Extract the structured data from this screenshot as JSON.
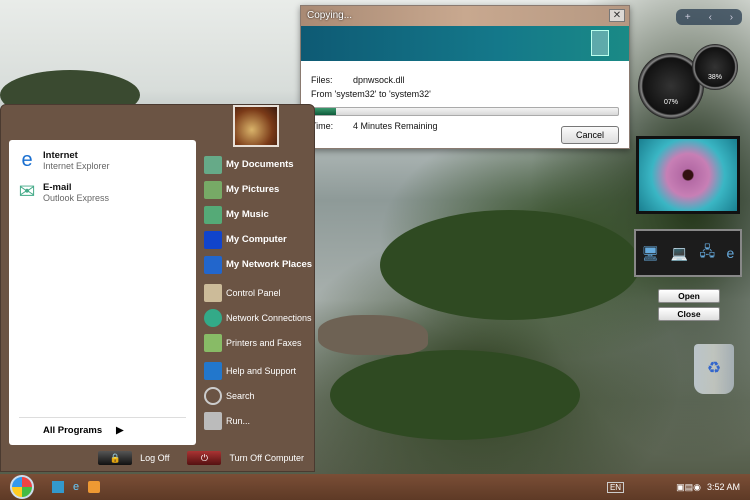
{
  "dialog": {
    "title": "Copying...",
    "close": "✕",
    "files_label": "Files:",
    "file_name": "dpnwsock.dll",
    "from_to": "From 'system32' to 'system32'",
    "progress_percent": 8,
    "time_label": "Time:",
    "time_value": "4 Minutes Remaining",
    "cancel": "Cancel"
  },
  "start_menu": {
    "pinned": [
      {
        "title": "Internet",
        "subtitle": "Internet Explorer",
        "icon": "internet-explorer-icon"
      },
      {
        "title": "E-mail",
        "subtitle": "Outlook Express",
        "icon": "outlook-express-icon"
      }
    ],
    "all_programs": "All Programs",
    "arrow": "▶",
    "places": [
      "My Documents",
      "My Pictures",
      "My Music",
      "My Computer",
      "My Network Places"
    ],
    "settings": [
      "Control Panel",
      "Network Connections",
      "Printers and Faxes"
    ],
    "help": [
      "Help and Support",
      "Search",
      "Run..."
    ],
    "log_off": "Log Off",
    "turn_off": "Turn Off Computer"
  },
  "gadgets": {
    "cpu_value": "07%",
    "mem_value": "38%",
    "open": "Open",
    "close": "Close",
    "toolbar_add": "+",
    "toolbar_prev": "‹",
    "toolbar_next": "›"
  },
  "taskbar": {
    "language": "EN",
    "clock": "3:52 AM"
  },
  "colors": {
    "start_menu": "#6b5444",
    "taskbar": "#6a4430",
    "dialog_banner": "#14788a",
    "progress": "#1f7a52"
  }
}
